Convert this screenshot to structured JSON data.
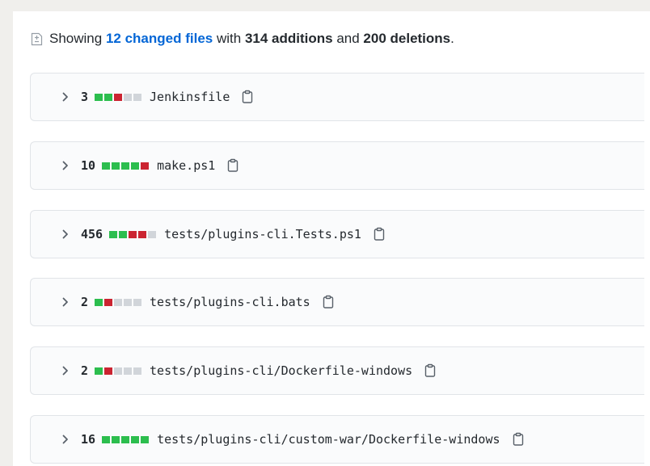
{
  "summary": {
    "prefix": "Showing",
    "changed_files": "12 changed files",
    "with": "with",
    "additions": "314 additions",
    "and": "and",
    "deletions": "200 deletions",
    "period": ".",
    "icon": "diff-icon"
  },
  "colors": {
    "addition": "#2cbe4e",
    "deletion": "#cb2431",
    "neutral": "#d1d5da",
    "link": "#0366d6"
  },
  "files": [
    {
      "count": "3",
      "name": "Jenkinsfile",
      "blocks": [
        "add",
        "add",
        "del",
        "neutral",
        "neutral"
      ]
    },
    {
      "count": "10",
      "name": "make.ps1",
      "blocks": [
        "add",
        "add",
        "add",
        "add",
        "del"
      ]
    },
    {
      "count": "456",
      "name": "tests/plugins-cli.Tests.ps1",
      "blocks": [
        "add",
        "add",
        "del",
        "del",
        "neutral"
      ]
    },
    {
      "count": "2",
      "name": "tests/plugins-cli.bats",
      "blocks": [
        "add",
        "del",
        "neutral",
        "neutral",
        "neutral"
      ]
    },
    {
      "count": "2",
      "name": "tests/plugins-cli/Dockerfile-windows",
      "blocks": [
        "add",
        "del",
        "neutral",
        "neutral",
        "neutral"
      ]
    },
    {
      "count": "16",
      "name": "tests/plugins-cli/custom-war/Dockerfile-windows",
      "blocks": [
        "add",
        "add",
        "add",
        "add",
        "add"
      ]
    }
  ]
}
